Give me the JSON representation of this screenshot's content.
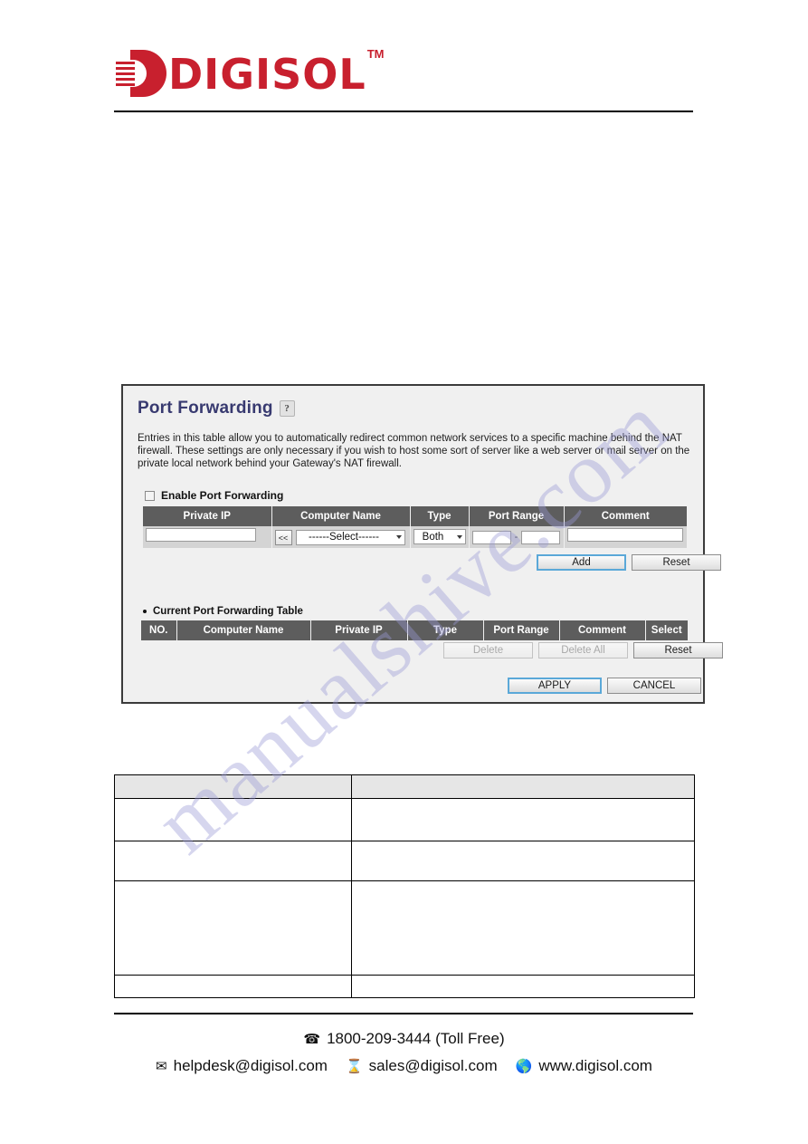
{
  "document": {
    "watermark": "manualshive.com",
    "brand": {
      "name": "DIGISOL",
      "trademark": "TM",
      "color": "#c8202e"
    }
  },
  "panel": {
    "title": "Port Forwarding",
    "help_icon_label": "?",
    "description": "Entries in this table allow you to automatically redirect common network services to a specific machine behind the NAT firewall. These settings are only necessary if you wish to host some sort of server like a web server or mail server on the private local network behind your Gateway's NAT firewall.",
    "enable_checkbox": {
      "label": "Enable Port Forwarding",
      "checked": false
    },
    "entry_table": {
      "columns": [
        "Private IP",
        "Computer Name",
        "Type",
        "Port Range",
        "Comment"
      ],
      "private_ip_value": "",
      "picker_button_label": "<<",
      "computer_name_select": "------Select------",
      "type_select": "Both",
      "port_range_start": "",
      "port_range_end": "",
      "port_range_separator": "-",
      "comment_value": ""
    },
    "entry_buttons": {
      "add_label": "Add",
      "reset_label": "Reset"
    },
    "current_table": {
      "heading": "Current Port Forwarding Table",
      "columns": [
        "NO.",
        "Computer Name",
        "Private IP",
        "Type",
        "Port Range",
        "Comment",
        "Select"
      ],
      "rows": []
    },
    "current_buttons": {
      "delete_label": "Delete",
      "delete_all_label": "Delete All",
      "reset_label": "Reset",
      "delete_disabled": true,
      "delete_all_disabled": true
    },
    "footer_buttons": {
      "apply_label": "APPLY",
      "cancel_label": "CANCEL"
    },
    "accent_focus_color": "#5aa8d8",
    "header_bg_color": "#5d5d5d"
  },
  "doc_table": {
    "rows": [
      {
        "left": "",
        "right": ""
      },
      {
        "left": "",
        "right": ""
      },
      {
        "left": "",
        "right": ""
      },
      {
        "left": "",
        "right": ""
      },
      {
        "left": "",
        "right": ""
      }
    ]
  },
  "footer": {
    "phone_icon": "phone-icon",
    "phone": "1800-209-3444 (Toll Free)",
    "helpdesk_icon": "mail-icon",
    "helpdesk_email": "helpdesk@digisol.com",
    "sales_icon": "hourglass-icon",
    "sales_email": "sales@digisol.com",
    "web_icon": "globe-icon",
    "website": "www.digisol.com"
  }
}
